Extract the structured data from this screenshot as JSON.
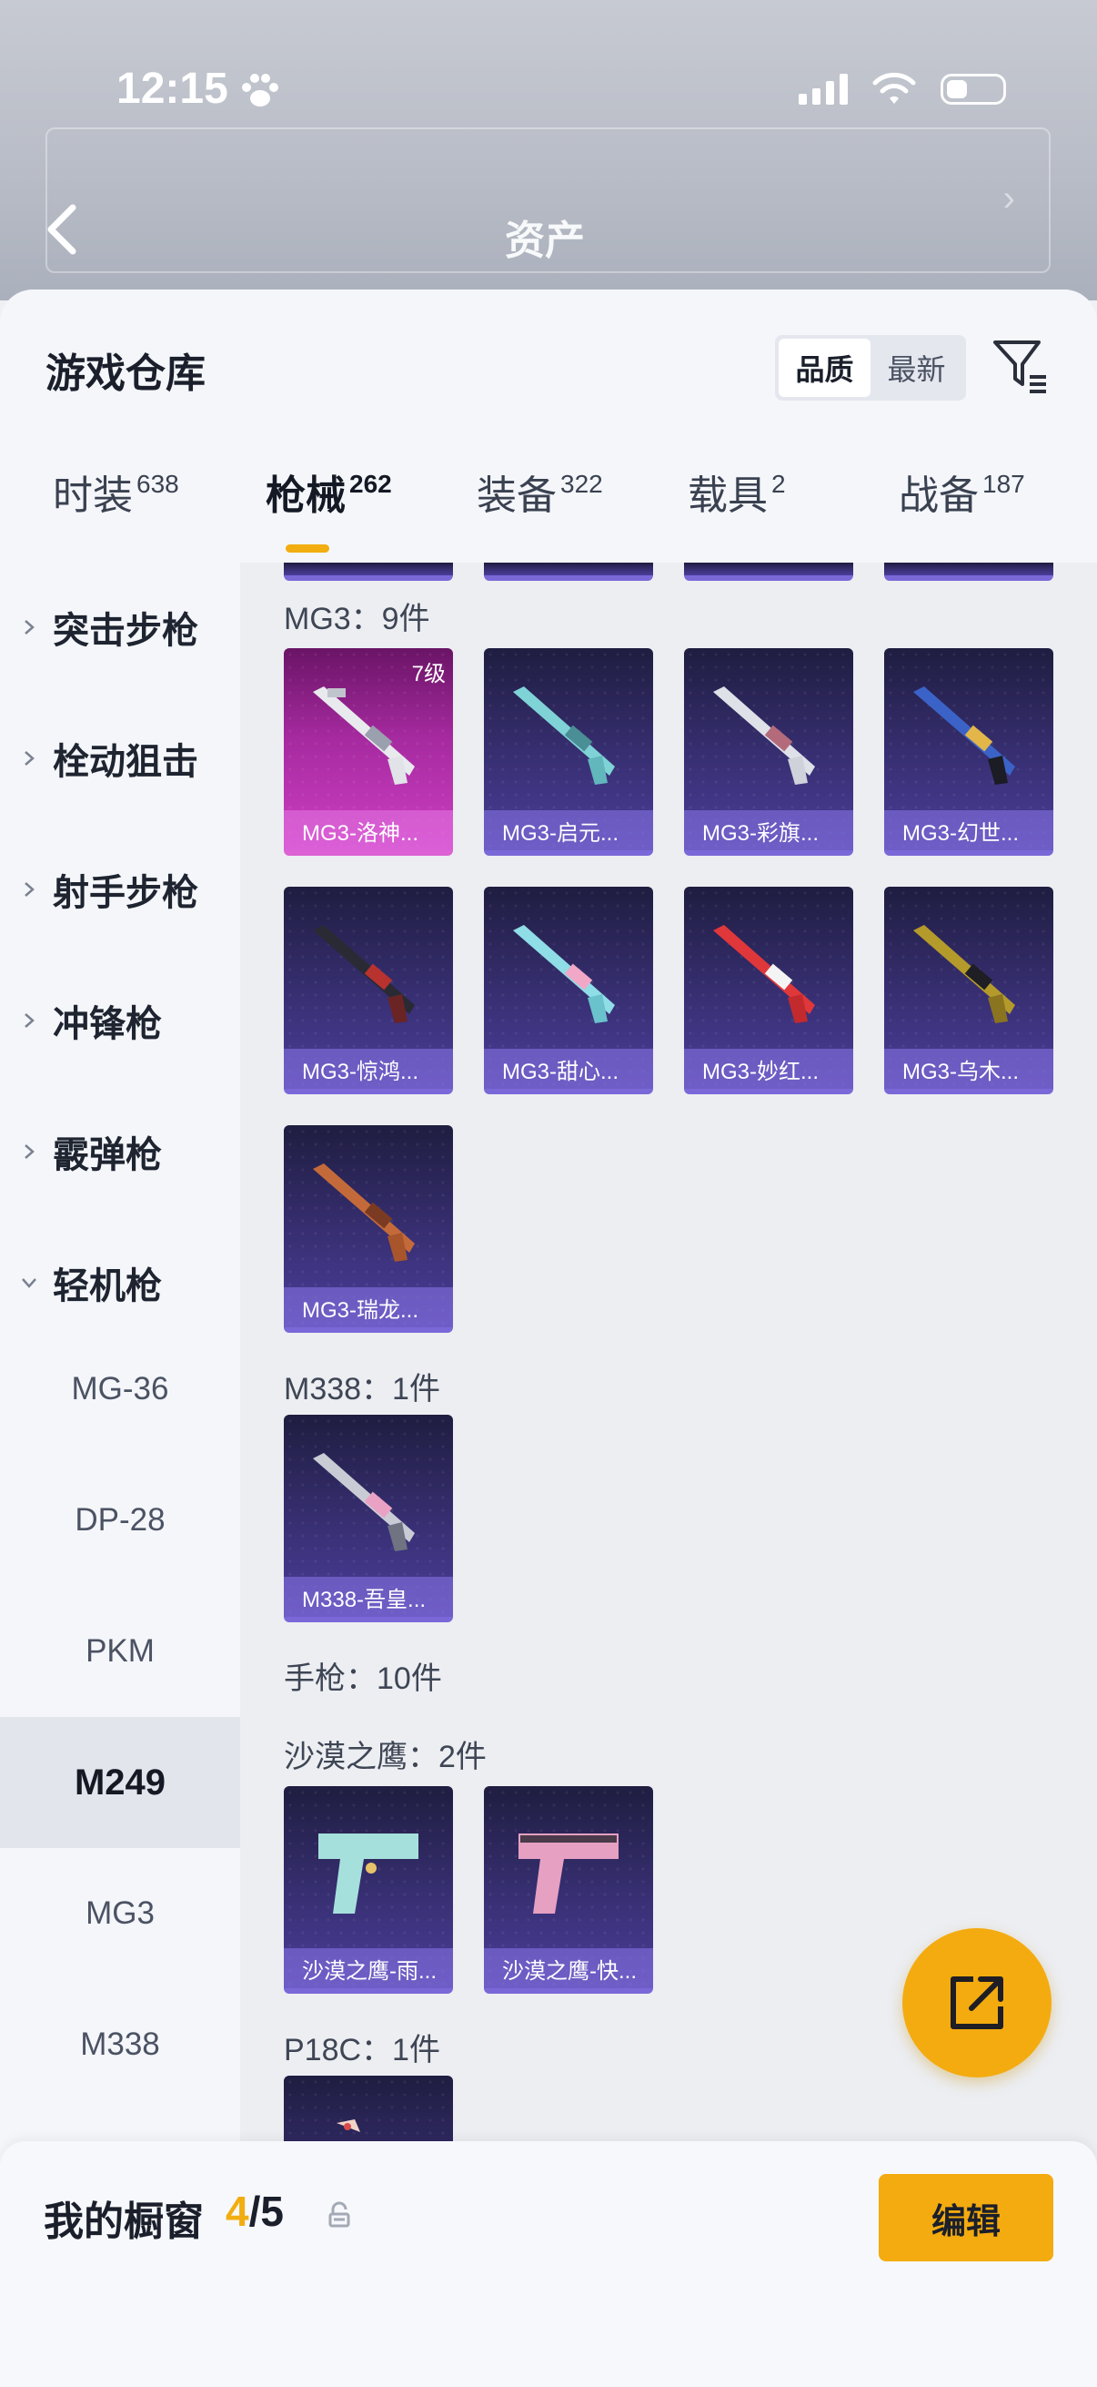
{
  "status_bar": {
    "time": "12:15"
  },
  "header": {
    "title": "资产"
  },
  "sheet": {
    "title": "游戏仓库",
    "sort_options": [
      "品质",
      "最新"
    ],
    "tabs": [
      {
        "label": "时装",
        "count": "638"
      },
      {
        "label": "枪械",
        "count": "262"
      },
      {
        "label": "装备",
        "count": "322"
      },
      {
        "label": "载具",
        "count": "2"
      },
      {
        "label": "战备",
        "count": "187"
      }
    ]
  },
  "sidebar": {
    "categories": [
      "突击步枪",
      "栓动狙击",
      "射手步枪",
      "冲锋枪",
      "霰弹枪",
      "轻机枪"
    ],
    "subitems": [
      "MG-36",
      "DP-28",
      "PKM",
      "M249",
      "MG3",
      "M338"
    ]
  },
  "groups": {
    "mg3": {
      "label": "MG3：9件",
      "items": [
        {
          "name": "MG3-洛神...",
          "level": "7级"
        },
        {
          "name": "MG3-启元..."
        },
        {
          "name": "MG3-彩旗..."
        },
        {
          "name": "MG3-幻世..."
        },
        {
          "name": "MG3-惊鸿..."
        },
        {
          "name": "MG3-甜心..."
        },
        {
          "name": "MG3-妙红..."
        },
        {
          "name": "MG3-乌木..."
        },
        {
          "name": "MG3-瑞龙..."
        }
      ]
    },
    "m338": {
      "label": "M338：1件",
      "items": [
        {
          "name": "M338-吾皇..."
        }
      ]
    },
    "pistol": {
      "label": "手枪：10件"
    },
    "deagle": {
      "label": "沙漠之鹰：2件",
      "items": [
        {
          "name": "沙漠之鹰-雨..."
        },
        {
          "name": "沙漠之鹰-快..."
        }
      ]
    },
    "p18c": {
      "label": "P18C：1件"
    }
  },
  "bottom_bar": {
    "title": "我的橱窗",
    "current": "4",
    "total": "/5",
    "edit_label": "编辑"
  },
  "icons": [
    "paw-icon",
    "signal-icon",
    "wifi-icon",
    "battery-icon",
    "back-icon",
    "filter-icon",
    "chevron-right-icon",
    "chevron-down-icon",
    "share-icon",
    "lock-icon"
  ],
  "colors": {
    "accent": "#f2ad10",
    "card_purple": "#3a3178",
    "card_pink": "#a62aa0"
  }
}
